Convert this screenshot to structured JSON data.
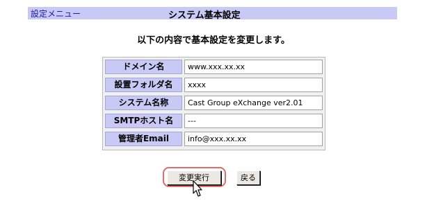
{
  "header": {
    "menu_link": "設定メニュー",
    "title": "システム基本設定"
  },
  "message": "以下の内容で基本設定を変更します。",
  "settings": [
    {
      "label": "ドメイン名",
      "value": "www.xxx.xx.xx"
    },
    {
      "label": "設置フォルダ名",
      "value": "xxxx"
    },
    {
      "label": "システム名称",
      "value": "Cast Group eXchange ver2.01"
    },
    {
      "label": "SMTPホスト名",
      "value": "---"
    },
    {
      "label": "管理者Email",
      "value": "info@xxx.xx.xx"
    }
  ],
  "buttons": {
    "execute": "変更実行",
    "back": "戻る"
  },
  "colors": {
    "header_bg": "#c9c9f5",
    "label_bg": "#c9c9f5",
    "highlight": "#e46a6a",
    "link": "#1a1aa6"
  },
  "icons": {
    "cursor": "pointer-arrow-icon"
  }
}
